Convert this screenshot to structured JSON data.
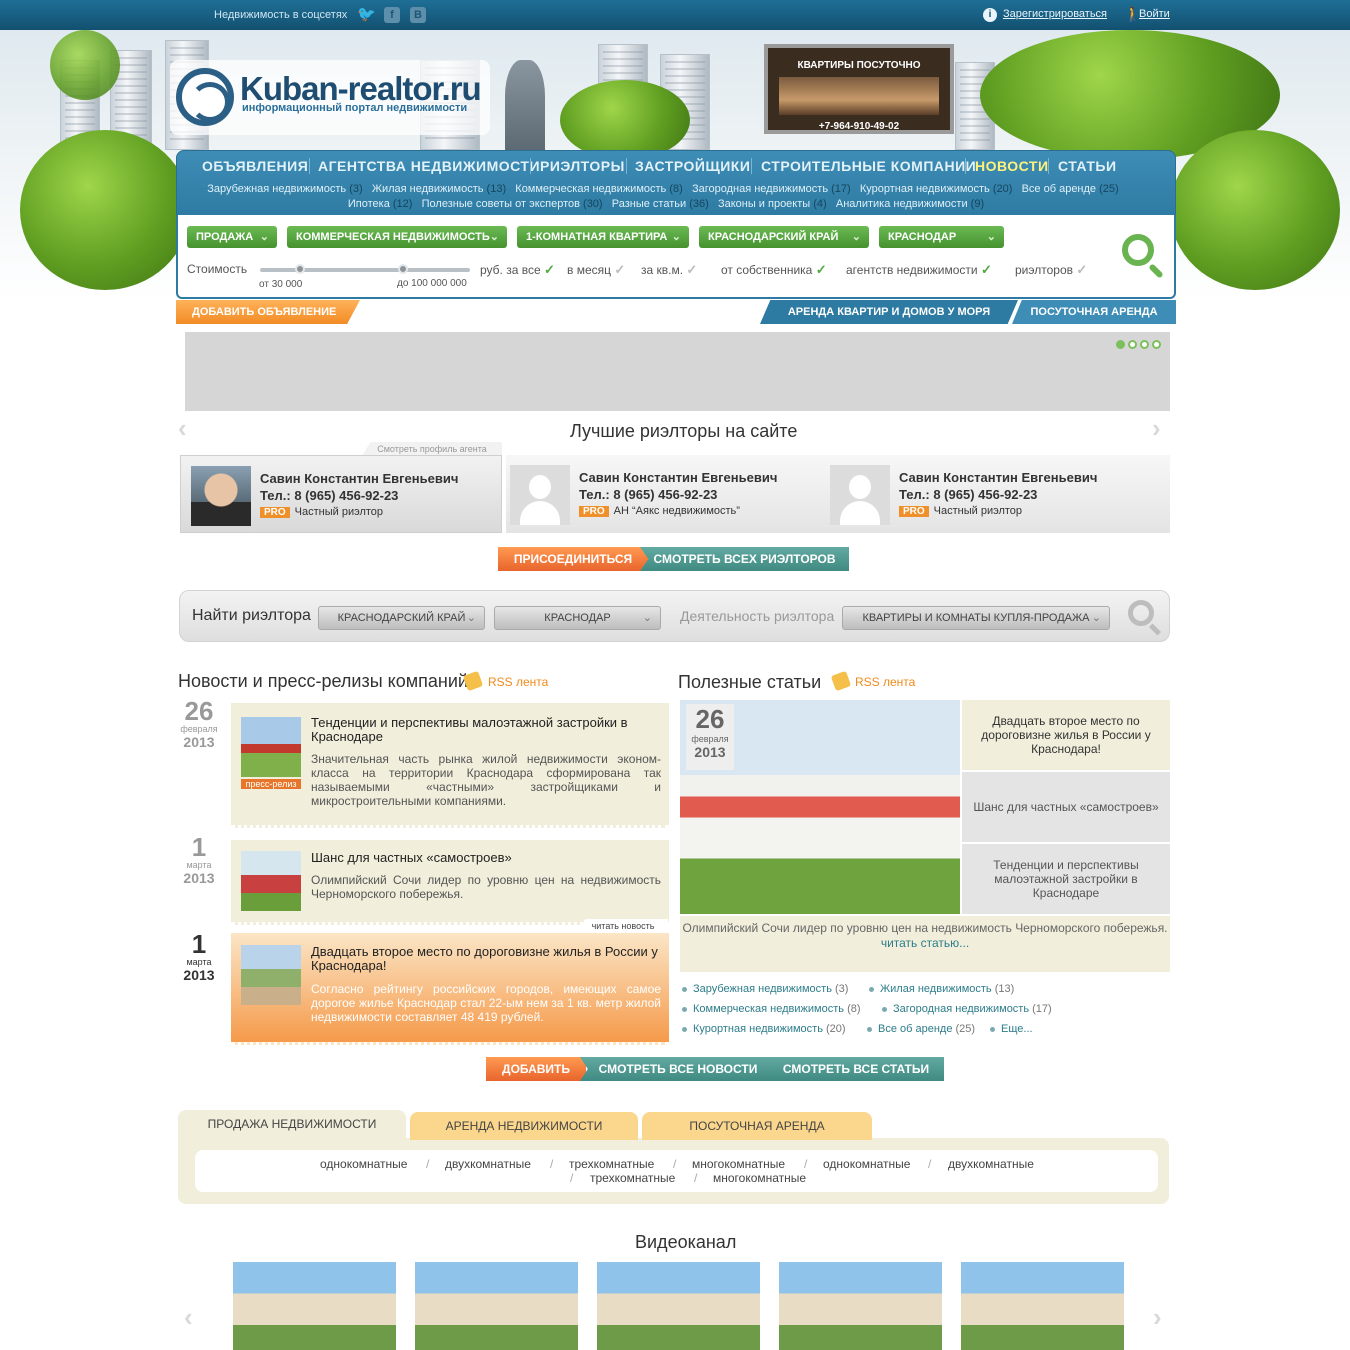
{
  "topbar": {
    "social_label": "Недвижимость в соцсетях",
    "social_icons": [
      "twitter-icon",
      "facebook-icon",
      "vkontakte-icon"
    ],
    "fb_glyph": "f",
    "vk_glyph": "B",
    "register": "Зарегистрироваться",
    "login": "Войти"
  },
  "logo": {
    "title": "Kuban-realtor.ru",
    "subtitle": "информационный портал недвижимости"
  },
  "billboard": {
    "title": "КВАРТИРЫ ПОСУТОЧНО",
    "phone": "+7-964-910-49-02"
  },
  "nav": {
    "items": [
      "ОБЪЯВЛЕНИЯ",
      "АГЕНТСТВА НЕДВИЖИМОСТИ",
      "РИЭЛТОРЫ",
      "ЗАСТРОЙЩИКИ",
      "СТРОИТЕЛЬНЫЕ КОМПАНИИ",
      "НОВОСТИ",
      "СТАТЬИ"
    ],
    "active": "НОВОСТИ",
    "sub": [
      {
        "label": "Зарубежная недвижимость",
        "count": "(3)"
      },
      {
        "label": "Жилая недвижимость",
        "count": "(13)"
      },
      {
        "label": "Коммерческая недвижимость",
        "count": "(8)"
      },
      {
        "label": "Загородная недвижимость",
        "count": "(17)"
      },
      {
        "label": "Курортная недвижимость",
        "count": "(20)"
      },
      {
        "label": "Все об аренде",
        "count": "(25)"
      },
      {
        "label": "Ипотека",
        "count": "(12)"
      },
      {
        "label": "Полезные советы от экспертов",
        "count": "(30)"
      },
      {
        "label": "Разные статьи",
        "count": "(36)"
      },
      {
        "label": "Законы и проекты",
        "count": "(4)"
      },
      {
        "label": "Аналитика недвижимости",
        "count": "(9)"
      }
    ]
  },
  "filter": {
    "dropdowns": [
      "ПРОДАЖА",
      "КОММЕРЧЕСКАЯ НЕДВИЖИМОСТЬ",
      "1-КОМНАТНАЯ КВАРТИРА",
      "КРАСНОДАРСКИЙ КРАЙ",
      "КРАСНОДАР"
    ],
    "price_label": "Стоимость",
    "price_from": "от 30 000",
    "price_to": "до 100 000 000",
    "unit_options": [
      "руб. за все",
      "в месяц",
      "за кв.м."
    ],
    "units_checked": [
      "руб. за все"
    ],
    "source_options": [
      "от собственника",
      "агентств недвижимости",
      "риэлторов"
    ],
    "sources_checked": [
      "от собственника",
      "агентств недвижимости"
    ],
    "check_glyph": "✓"
  },
  "actions": {
    "add_ad": "ДОБАВИТЬ ОБЪЯВЛЕНИЕ",
    "sea_rent": "АРЕНДА КВАРТИР И ДОМОВ У МОРЯ",
    "daily_rent": "ПОСУТОЧНАЯ АРЕНДА"
  },
  "arrows": {
    "prev": "‹",
    "next": "›"
  },
  "realtors": {
    "title": "Лучшие риэлторы на сайте",
    "profile_tab": "Смотреть профиль агента",
    "cards": [
      {
        "name": "Савин Константин Евгеньевич",
        "phone": "Тел.: 8 (965) 456-92-23",
        "badge": "PRO",
        "type": "Частный риэлтор"
      },
      {
        "name": "Савин Константин Евгеньевич",
        "phone": "Тел.: 8 (965) 456-92-23",
        "badge": "PRO",
        "type": "АН “Аякс недвижимость”"
      },
      {
        "name": "Савин Константин Евгеньевич",
        "phone": "Тел.: 8 (965) 456-92-23",
        "badge": "PRO",
        "type": "Частный риэлтор"
      }
    ],
    "join": "ПРИСОЕДИНИТЬСЯ",
    "see_all": "СМОТРЕТЬ ВСЕХ РИЭЛТОРОВ"
  },
  "find": {
    "label": "Найти риэлтора",
    "region": "КРАСНОДАРСКИЙ КРАЙ",
    "city": "КРАСНОДАР",
    "activity_label": "Деятельность риэлтора",
    "activity": "КВАРТИРЫ И КОМНАТЫ КУПЛЯ-ПРОДАЖА",
    "chevron": "⌄"
  },
  "news": {
    "title": "Новости и пресс-релизы компаний",
    "rss": "RSS лента",
    "press_tag": "пресс-релиз",
    "read_tag": "читать новость",
    "items": [
      {
        "day": "26",
        "month": "февраля",
        "year": "2013",
        "title": "Тенденции и перспективы малоэтажной застройки в Краснодаре",
        "text": "Значительная часть рынка жилой недвижимости эконом-класса на территории Краснодара сформирована так называемыми «частными» застройщиками и микростроительными компаниями."
      },
      {
        "day": "1",
        "month": "марта",
        "year": "2013",
        "title": "Шанс для частных «самостроев»",
        "text": "Олимпийский Сочи лидер по уровню цен на недвижимость Черноморского побережья."
      },
      {
        "day": "1",
        "month": "марта",
        "year": "2013",
        "title": "Двадцать второе место по дороговизне жилья в России у Краснодара!",
        "text": "Согласно рейтингу российских городов, имеющих самое дорогое жилье Краснодар стал 22-ым нем за 1 кв. метр жилой недвижимости составляет 48 419 рублей."
      }
    ]
  },
  "articles": {
    "title": "Полезные статьи",
    "rss": "RSS лента",
    "date": {
      "day": "26",
      "month": "февраля",
      "year": "2013"
    },
    "items": [
      "Двадцать второе место по дороговизне жилья в России у Краснодара!",
      "Шанс для частных «самостроев»",
      "Тенденции и перспективы малоэтажной застройки в Краснодаре"
    ],
    "desc": "Олимпийский Сочи лидер по уровню цен на недвижимость Черноморского побережья.",
    "read_more": "читать статью...",
    "categories": [
      {
        "label": "Зарубежная недвижимость",
        "count": "(3)"
      },
      {
        "label": "Жилая недвижимость",
        "count": "(13)"
      },
      {
        "label": "Коммерческая недвижимость",
        "count": "(8)"
      },
      {
        "label": "Загородная недвижимость",
        "count": "(17)"
      },
      {
        "label": "Курортная недвижимость",
        "count": "(20)"
      },
      {
        "label": "Все об аренде",
        "count": "(25)"
      },
      {
        "label": "Еще...",
        "count": ""
      }
    ]
  },
  "bottom_buttons": {
    "add": "ДОБАВИТЬ",
    "all_news": "СМОТРЕТЬ ВСЕ НОВОСТИ",
    "all_articles": "СМОТРЕТЬ ВСЕ СТАТЬИ"
  },
  "tabs": {
    "items": [
      "ПРОДАЖА НЕДВИЖИМОСТИ",
      "АРЕНДА НЕДВИЖИМОСТИ",
      "ПОСУТОЧНАЯ АРЕНДА"
    ],
    "active": "ПРОДАЖА НЕДВИЖИМОСТИ",
    "links_row1": [
      "однокомнатные",
      "двухкомнатные",
      "трехкомнатные",
      "многокомнатные",
      "однокомнатные",
      "двухкомнатные"
    ],
    "links_row2": [
      "трехкомнатные",
      "многокомнатные"
    ],
    "separator": "/"
  },
  "video": {
    "title": "Видеоканал",
    "count": 5
  }
}
